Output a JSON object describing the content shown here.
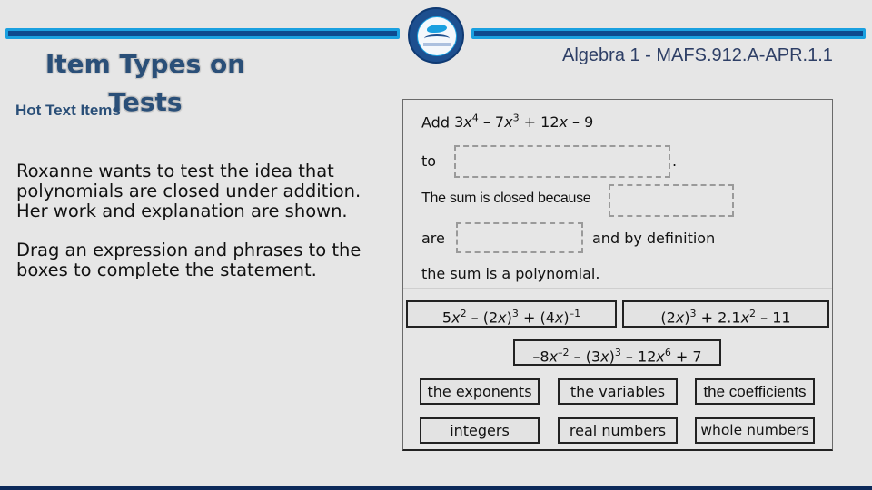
{
  "header": {
    "title": "Item Types on Tests",
    "subtitle": "Hot Text Items",
    "standard": "Algebra 1 - MAFS.912.A-APR.1.1",
    "logo_icon": "school-district-seal-icon"
  },
  "prompt": {
    "paragraph1": "Roxanne wants to test the idea that polynomials are closed under addition. Her work and explanation are shown.",
    "paragraph2": "Drag an expression and phrases to the boxes to complete the statement."
  },
  "statement": {
    "line1_prefix": "Add",
    "line1_expression": "3x^4 − 7x^3 + 12x − 9",
    "line2_prefix": "to",
    "line2_suffix": ".",
    "line3_prefix": "The sum is closed because",
    "line4_prefix": "are",
    "line4_suffix": "and by definition",
    "line5": "the sum is a polynomial."
  },
  "drop_zones": [
    {
      "name": "expression-drop-zone",
      "value": ""
    },
    {
      "name": "property-drop-zone",
      "value": ""
    },
    {
      "name": "number-set-drop-zone",
      "value": ""
    }
  ],
  "expression_tiles": [
    "5x^2 − (2x)^3 + (4x)^−1",
    "(2x)^3 + 2.1x^2 − 11",
    "−8x^−2 − (3x)^3 − 12x^6 + 7"
  ],
  "phrase_tiles": {
    "row1": [
      "the exponents",
      "the variables",
      "the coefficients"
    ],
    "row2": [
      "integers",
      "real numbers",
      "whole numbers"
    ]
  }
}
